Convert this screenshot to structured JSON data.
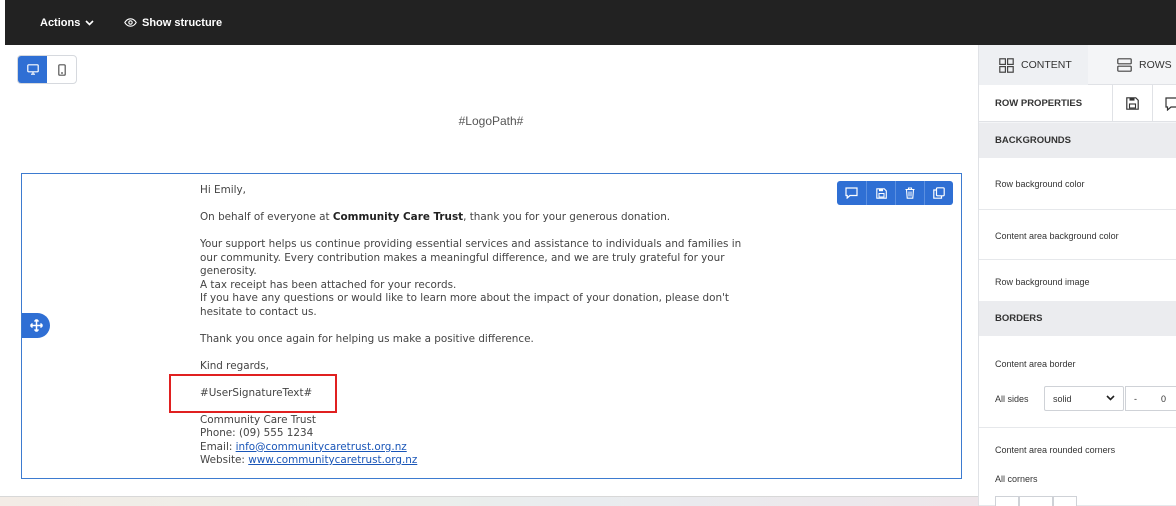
{
  "topbar": {
    "actions_label": "Actions",
    "show_structure_label": "Show structure"
  },
  "canvas": {
    "logo_placeholder": "#LogoPath#"
  },
  "email": {
    "greeting": "Hi Emily,",
    "intro_before": "On behalf of everyone at ",
    "org_name": "Community Care Trust",
    "intro_after": ", thank you for your generous donation.",
    "para2_line1": "Your support helps us continue providing essential services and assistance to individuals and families in",
    "para2_line2": "our community. Every contribution makes a meaningful difference, and we are truly grateful for your",
    "para2_line3": "generosity.",
    "para2_line4": "A tax receipt has been attached for your records.",
    "para2_line5": "If you have any questions or would like to learn more about the impact of your donation, please don't",
    "para2_line6": "hesitate to contact us.",
    "thanks": "Thank you once again for helping us make a positive difference.",
    "closing": "Kind regards,",
    "signature_placeholder": "#UserSignatureText#",
    "footer_org": "Community Care Trust",
    "phone_line": "Phone: (09) 555 1234",
    "email_label": "Email: ",
    "email_link": "info@communitycaretrust.org.nz",
    "website_label": "Website: ",
    "website_link": "www.communitycaretrust.org.nz"
  },
  "panel": {
    "tabs": {
      "content": "CONTENT",
      "rows": "ROWS"
    },
    "row_properties": "ROW PROPERTIES",
    "backgrounds_heading": "BACKGROUNDS",
    "row_bg_color": "Row background color",
    "content_bg_color": "Content area background color",
    "row_bg_image": "Row background image",
    "borders_heading": "BORDERS",
    "content_border": "Content area border",
    "all_sides": "All sides",
    "border_style": "solid",
    "minus": "-",
    "border_width": "0",
    "rounded_corners": "Content area rounded corners",
    "all_corners": "All corners"
  },
  "colors": {
    "accent": "#2f6fd4",
    "topbar_bg": "#222222",
    "highlight_box": "#e02020"
  },
  "icons": {
    "actions_chevron": "chevron-down-icon",
    "show_structure": "eye-icon",
    "desktop": "desktop-icon",
    "mobile": "mobile-icon",
    "comment": "comment-icon",
    "save": "save-icon",
    "delete": "trash-icon",
    "duplicate": "copy-icon",
    "move": "move-icon",
    "content_tab": "grid-icon",
    "rows_tab": "rows-icon"
  }
}
